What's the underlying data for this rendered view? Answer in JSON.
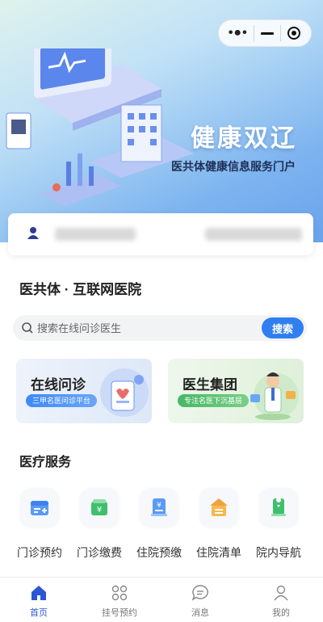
{
  "capsule": {
    "more_icon": "more-dots-icon",
    "minimize_icon": "minimize-icon",
    "close_icon": "target-close-icon"
  },
  "hero": {
    "title": "健康双辽",
    "subtitle": "医共体健康信息服务门户"
  },
  "user_card": {
    "icon": "user-icon"
  },
  "hospital_section": {
    "title": "医共体 · 互联网医院"
  },
  "search": {
    "placeholder": "搜索在线问诊医生",
    "button": "搜索"
  },
  "feature_cards": [
    {
      "title": "在线问诊",
      "badge": "三甲名医问诊平台"
    },
    {
      "title": "医生集团",
      "badge": "专注名医下沉基层"
    }
  ],
  "medical_section": {
    "title": "医疗服务"
  },
  "services": [
    {
      "label": "门诊预约",
      "icon": "calendar-icon"
    },
    {
      "label": "门诊缴费",
      "icon": "yuan-wallet-icon"
    },
    {
      "label": "住院预缴",
      "icon": "yuan-bill-icon"
    },
    {
      "label": "住院清单",
      "icon": "checklist-icon"
    },
    {
      "label": "院内导航",
      "icon": "location-icon"
    }
  ],
  "tabbar": [
    {
      "label": "首页",
      "icon": "home-icon",
      "active": true
    },
    {
      "label": "挂号预约",
      "icon": "grid-icon",
      "active": false
    },
    {
      "label": "消息",
      "icon": "message-icon",
      "active": false
    },
    {
      "label": "我的",
      "icon": "profile-icon",
      "active": false
    }
  ],
  "colors": {
    "accent": "#2f7ff0",
    "tab_active": "#2c56d4",
    "green": "#46b866"
  }
}
